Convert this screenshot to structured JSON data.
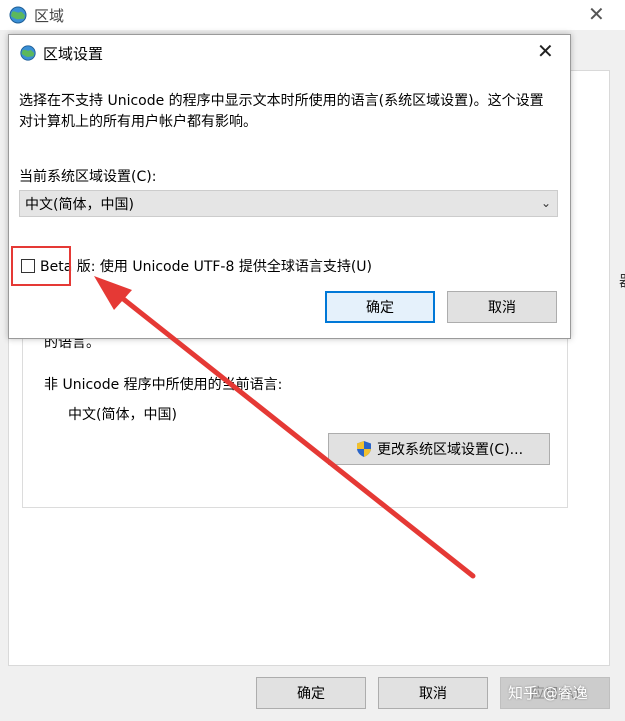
{
  "background_window": {
    "title": "区域",
    "partial_text": "的语言。",
    "nonunicode_label": "非 Unicode 程序中所使用的当前语言:",
    "current_language": "中文(简体，中国)",
    "change_button_label": "更改系统区域设置(C)...",
    "edge_char": "器",
    "buttons": {
      "ok": "确定",
      "cancel": "取消",
      "apply": "应用(A)"
    }
  },
  "dialog": {
    "title": "区域设置",
    "description": "选择在不支持 Unicode 的程序中显示文本时所使用的语言(系统区域设置)。这个设置对计算机上的所有用户帐户都有影响。",
    "select_label": "当前系统区域设置(C):",
    "select_value": "中文(简体，中国)",
    "beta_checkbox_label": "Beta 版: 使用 Unicode UTF-8 提供全球语言支持(U)",
    "beta_checked": false,
    "ok_label": "确定",
    "cancel_label": "取消"
  },
  "watermark": "知乎 @睿逸",
  "colors": {
    "annotation_red": "#e53935",
    "accent_blue": "#0078d7"
  },
  "icons": {
    "window_icon": "globe-icon",
    "shield": "uac-shield-icon",
    "close": "close-icon",
    "dropdown": "chevron-down-icon"
  }
}
